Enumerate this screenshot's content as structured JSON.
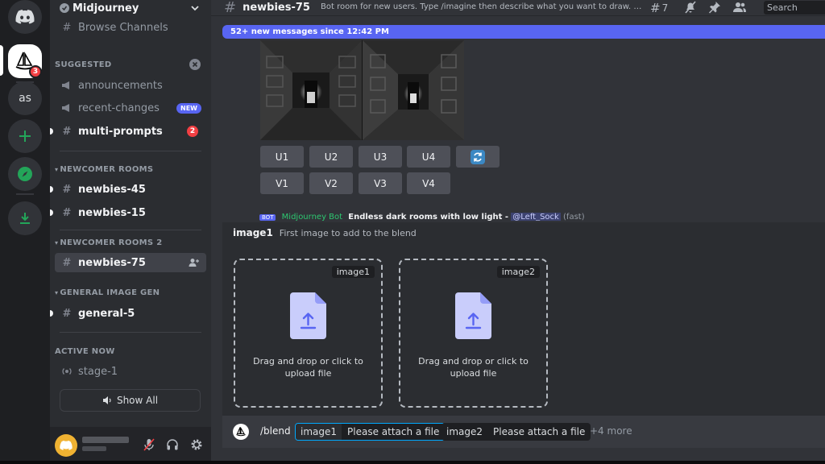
{
  "rail": {
    "home_icon": "discord-logo-icon",
    "server_badge": "3",
    "server2_label": "as",
    "add_icon": "plus-icon",
    "explore_icon": "compass-icon",
    "download_icon": "download-icon"
  },
  "sidebar": {
    "server_name": "Midjourney",
    "browse_label": "Browse Channels",
    "suggested": {
      "title": "SUGGESTED",
      "channels": [
        {
          "name": "announcements"
        },
        {
          "name": "recent-changes",
          "badge": "NEW"
        },
        {
          "name": "multi-prompts",
          "badge": "2"
        }
      ]
    },
    "newcomer_rooms": {
      "title": "NEWCOMER ROOMS",
      "channels": [
        {
          "name": "newbies-45"
        },
        {
          "name": "newbies-15"
        }
      ]
    },
    "newcomer_rooms_2": {
      "title": "NEWCOMER ROOMS 2",
      "channels": [
        {
          "name": "newbies-75"
        }
      ]
    },
    "general_image_gen": {
      "title": "GENERAL IMAGE GEN",
      "channels": [
        {
          "name": "general-5"
        }
      ]
    },
    "active_now": {
      "title": "ACTIVE NOW",
      "stage": "stage-1"
    },
    "show_all_label": "Show All"
  },
  "topbar": {
    "channel": "newbies-75",
    "topic": "Bot room for new users. Type /imagine then describe what you want to draw. …",
    "threads_count": "7",
    "search_placeholder": "Search"
  },
  "chat": {
    "new_messages_banner": "52+ new messages since 12:42 PM",
    "upscale_buttons": [
      "U1",
      "U2",
      "U3",
      "U4"
    ],
    "variation_buttons": [
      "V1",
      "V2",
      "V3",
      "V4"
    ],
    "reroll_icon": "refresh-icon",
    "peek": {
      "bot_tag": "BOT",
      "bot_name": "Midjourney Bot",
      "message": "Endless dark rooms with low light -",
      "mention": "@Left_Sock",
      "speed": "(fast)"
    }
  },
  "option_panel": {
    "option_name": "image1",
    "option_desc": "First image to add to the blend",
    "dropzones": [
      {
        "tag": "image1",
        "text": "Drag and drop or click to upload file"
      },
      {
        "tag": "image2",
        "text": "Drag and drop or click to upload file"
      }
    ]
  },
  "command": {
    "name": "/blend",
    "options": [
      {
        "key": "image1",
        "value": "Please attach a file"
      },
      {
        "key": "image2",
        "value": "Please attach a file"
      }
    ],
    "more": "+4 more"
  },
  "colors": {
    "accent": "#5865f2",
    "danger": "#f23f43",
    "bot_name": "#2dc770",
    "focus": "#00a8fc"
  }
}
